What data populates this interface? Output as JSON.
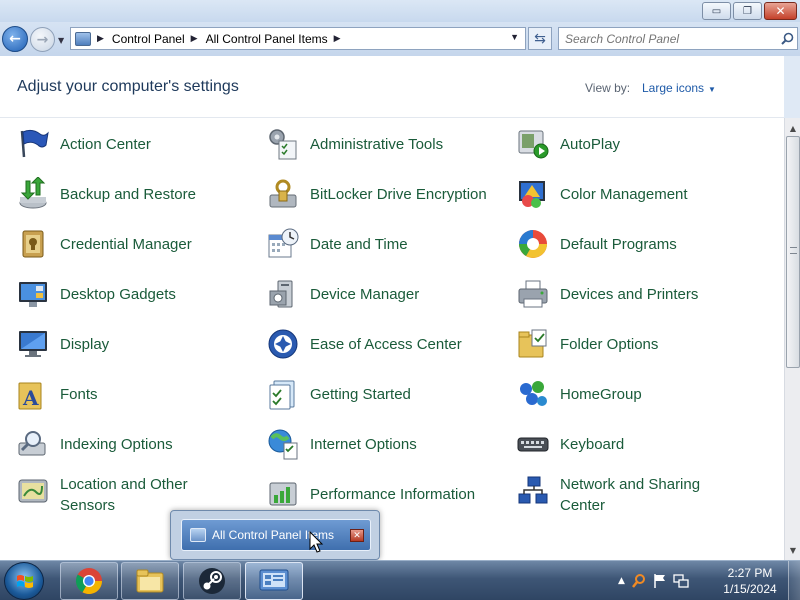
{
  "window": {
    "minimize_label": "▭",
    "maximize_label": "❐",
    "close_label": "✕"
  },
  "address": {
    "crumbs": [
      "Control Panel",
      "All Control Panel Items"
    ],
    "search_placeholder": "Search Control Panel"
  },
  "header": {
    "title": "Adjust your computer's settings",
    "view_by_label": "View by:",
    "view_by_value": "Large icons"
  },
  "items": [
    {
      "label": "Action Center",
      "icon": "flag-icon",
      "col": 0,
      "row": 0
    },
    {
      "label": "Administrative Tools",
      "icon": "admin-tools-icon",
      "col": 1,
      "row": 0
    },
    {
      "label": "AutoPlay",
      "icon": "autoplay-icon",
      "col": 2,
      "row": 0
    },
    {
      "label": "Backup and Restore",
      "icon": "backup-icon",
      "col": 0,
      "row": 1
    },
    {
      "label": "BitLocker Drive Encryption",
      "icon": "bitlocker-icon",
      "col": 1,
      "row": 1
    },
    {
      "label": "Color Management",
      "icon": "color-management-icon",
      "col": 2,
      "row": 1
    },
    {
      "label": "Credential Manager",
      "icon": "credential-manager-icon",
      "col": 0,
      "row": 2
    },
    {
      "label": "Date and Time",
      "icon": "calendar-clock-icon",
      "col": 1,
      "row": 2
    },
    {
      "label": "Default Programs",
      "icon": "default-programs-icon",
      "col": 2,
      "row": 2
    },
    {
      "label": "Desktop Gadgets",
      "icon": "desktop-gadgets-icon",
      "col": 0,
      "row": 3
    },
    {
      "label": "Device Manager",
      "icon": "device-manager-icon",
      "col": 1,
      "row": 3
    },
    {
      "label": "Devices and Printers",
      "icon": "printer-icon",
      "col": 2,
      "row": 3
    },
    {
      "label": "Display",
      "icon": "monitor-icon",
      "col": 0,
      "row": 4
    },
    {
      "label": "Ease of Access Center",
      "icon": "ease-of-access-icon",
      "col": 1,
      "row": 4
    },
    {
      "label": "Folder Options",
      "icon": "folder-options-icon",
      "col": 2,
      "row": 4
    },
    {
      "label": "Fonts",
      "icon": "fonts-folder-icon",
      "col": 0,
      "row": 5
    },
    {
      "label": "Getting Started",
      "icon": "getting-started-icon",
      "col": 1,
      "row": 5
    },
    {
      "label": "HomeGroup",
      "icon": "homegroup-icon",
      "col": 2,
      "row": 5
    },
    {
      "label": "Indexing Options",
      "icon": "indexing-icon",
      "col": 0,
      "row": 6
    },
    {
      "label": "Internet Options",
      "icon": "internet-options-icon",
      "col": 1,
      "row": 6
    },
    {
      "label": "Keyboard",
      "icon": "keyboard-icon",
      "col": 2,
      "row": 6
    },
    {
      "label": "Location and Other Sensors",
      "icon": "location-sensors-icon",
      "col": 0,
      "row": 7
    },
    {
      "label": "Performance Information",
      "icon": "performance-icon",
      "col": 1,
      "row": 7
    },
    {
      "label": "Network and Sharing Center",
      "icon": "network-icon",
      "col": 2,
      "row": 7
    }
  ],
  "thumbnail": {
    "title": "All Control Panel Items",
    "close_label": "✕"
  },
  "taskbar": {
    "apps": [
      "chrome-icon",
      "folder-icon",
      "steam-icon",
      "control-panel-icon"
    ],
    "time": "2:27 PM",
    "date": "1/15/2024"
  },
  "colors": {
    "link_green": "#1a5b3a",
    "title_blue": "#1e395b",
    "accent_blue": "#1e5aa8"
  }
}
